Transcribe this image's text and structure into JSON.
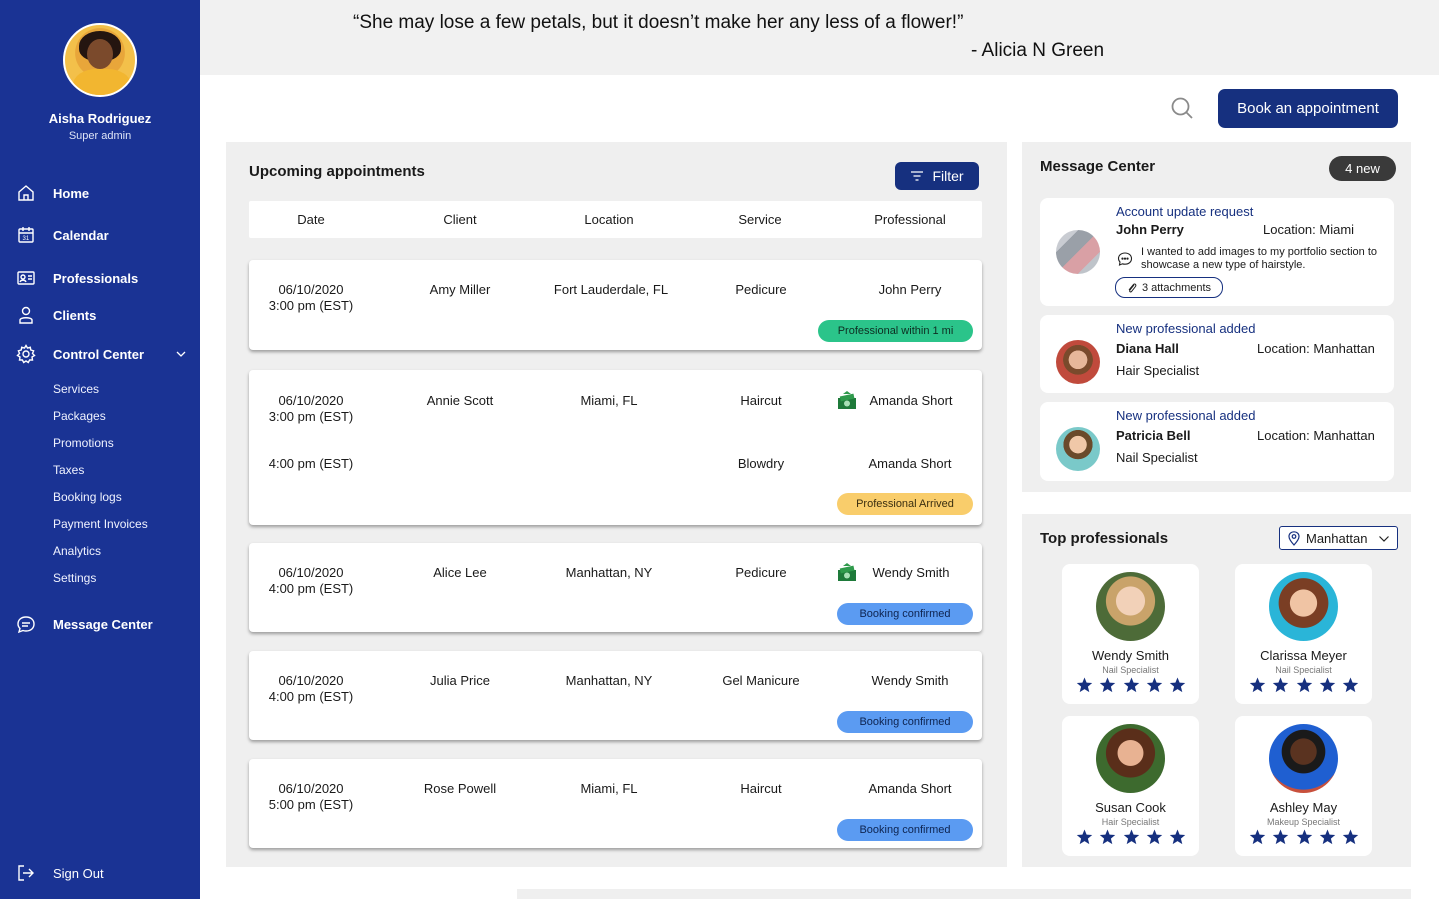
{
  "user": {
    "name": "Aisha Rodriguez",
    "role": "Super admin"
  },
  "nav": {
    "home": "Home",
    "calendar": "Calendar",
    "professionals": "Professionals",
    "clients": "Clients",
    "control_center": "Control Center",
    "sub_items": [
      "Services",
      "Packages",
      "Promotions",
      "Taxes",
      "Booking logs",
      "Payment Invoices",
      "Analytics",
      "Settings"
    ],
    "message_center": "Message Center",
    "sign_out": "Sign Out"
  },
  "quote": {
    "text": "“She may lose a few petals, but it doesn’t make her any less of a flower!”",
    "author": "- Alicia N Green"
  },
  "actions": {
    "book": "Book an appointment"
  },
  "appointments": {
    "title": "Upcoming appointments",
    "filter": "Filter",
    "columns": [
      "Date",
      "Client",
      "Location",
      "Service",
      "Professional"
    ],
    "rows": [
      {
        "date": "06/10/2020",
        "time": "3:00 pm (EST)",
        "client": "Amy Miller",
        "location": "Fort Lauderdale, FL",
        "service": "Pedicure",
        "professional": "John Perry",
        "status": "Professional within 1 mi"
      },
      {
        "date": "06/10/2020",
        "time": "3:00 pm (EST)",
        "client": "Annie Scott",
        "location": "Miami, FL",
        "service": "Haircut",
        "professional": "Amanda Short",
        "time2": "4:00 pm (EST)",
        "service2": "Blowdry",
        "professional2": "Amanda Short",
        "status": "Professional Arrived"
      },
      {
        "date": "06/10/2020",
        "time": "4:00 pm (EST)",
        "client": "Alice Lee",
        "location": "Manhattan, NY",
        "service": "Pedicure",
        "professional": "Wendy Smith",
        "status": "Booking confirmed"
      },
      {
        "date": "06/10/2020",
        "time": "4:00 pm (EST)",
        "client": "Julia Price",
        "location": "Manhattan, NY",
        "service": "Gel Manicure",
        "professional": "Wendy Smith",
        "status": "Booking confirmed"
      },
      {
        "date": "06/10/2020",
        "time": "5:00 pm (EST)",
        "client": "Rose Powell",
        "location": "Miami, FL",
        "service": "Haircut",
        "professional": "Amanda Short",
        "status": "Booking confirmed"
      }
    ]
  },
  "messages": {
    "title": "Message Center",
    "new_count": "4 new",
    "items": [
      {
        "title": "Account update request",
        "name": "John Perry",
        "location": "Location: Miami",
        "text": "I wanted to add images to my portfolio section to showcase a new type of hairstyle.",
        "attachments": "3 attachments"
      },
      {
        "title": "New professional added",
        "name": "Diana Hall",
        "location": "Location: Manhattan",
        "role": "Hair Specialist"
      },
      {
        "title": "New professional added",
        "name": "Patricia Bell",
        "location": "Location: Manhattan",
        "role": "Nail Specialist"
      }
    ]
  },
  "top_professionals": {
    "title": "Top professionals",
    "location": "Manhattan",
    "items": [
      {
        "name": "Wendy Smith",
        "role": "Nail Specialist",
        "rating": 5
      },
      {
        "name": "Clarissa Meyer",
        "role": "Nail Specialist",
        "rating": 5
      },
      {
        "name": "Susan Cook",
        "role": "Hair Specialist",
        "rating": 5
      },
      {
        "name": "Ashley May",
        "role": "Makeup Specialist",
        "rating": 5
      }
    ]
  },
  "colors": {
    "brand": "#1a3394",
    "button": "#16307f",
    "status_green": "#2bc48a",
    "status_yellow": "#f9cd6b",
    "status_blue": "#5b9bf2"
  }
}
